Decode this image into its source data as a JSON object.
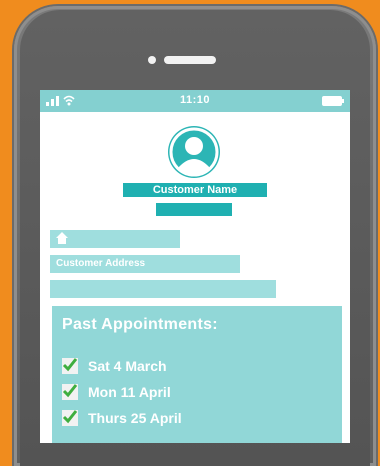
{
  "status": {
    "time": "11:10",
    "signal_icon": "signal-icon",
    "wifi_icon": "wifi-icon",
    "battery_icon": "battery-icon"
  },
  "profile": {
    "avatar_icon": "user-avatar-icon",
    "name_label": "Customer Name"
  },
  "address": {
    "home_icon": "home-icon",
    "address_label": "Customer Address"
  },
  "past_appointments": {
    "title": "Past Appointments:",
    "items": [
      {
        "label": "Sat 4 March",
        "checked": true
      },
      {
        "label": "Mon 11 April",
        "checked": true
      },
      {
        "label": "Thurs 25 April",
        "checked": true
      }
    ]
  },
  "colors": {
    "background": "#f08c1e",
    "phone_body": "#5f5f5f",
    "teal_dark": "#1fb0b1",
    "teal_light": "#9fdede",
    "panel": "#91d7d7",
    "check": "#3fae3f"
  }
}
